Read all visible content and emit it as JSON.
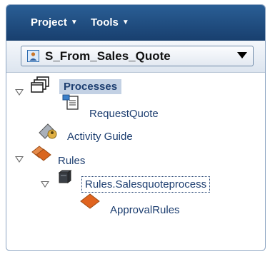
{
  "menubar": {
    "project_label": "Project",
    "tools_label": "Tools"
  },
  "selector": {
    "value": "S_From_Sales_Quote"
  },
  "tree": {
    "processes": {
      "label": "Processes"
    },
    "request_quote": {
      "label": "RequestQuote"
    },
    "activity_guide": {
      "label": "Activity Guide"
    },
    "rules": {
      "label": "Rules"
    },
    "rules_process": {
      "label": "Rules.Salesquoteprocess"
    },
    "approval_rules": {
      "label": "ApprovalRules"
    }
  },
  "colors": {
    "menubar": "#1f4b80",
    "tree_text": "#1d3e70",
    "selected_bg": "#c3d1e4",
    "rule_icon": "#e0641f"
  }
}
